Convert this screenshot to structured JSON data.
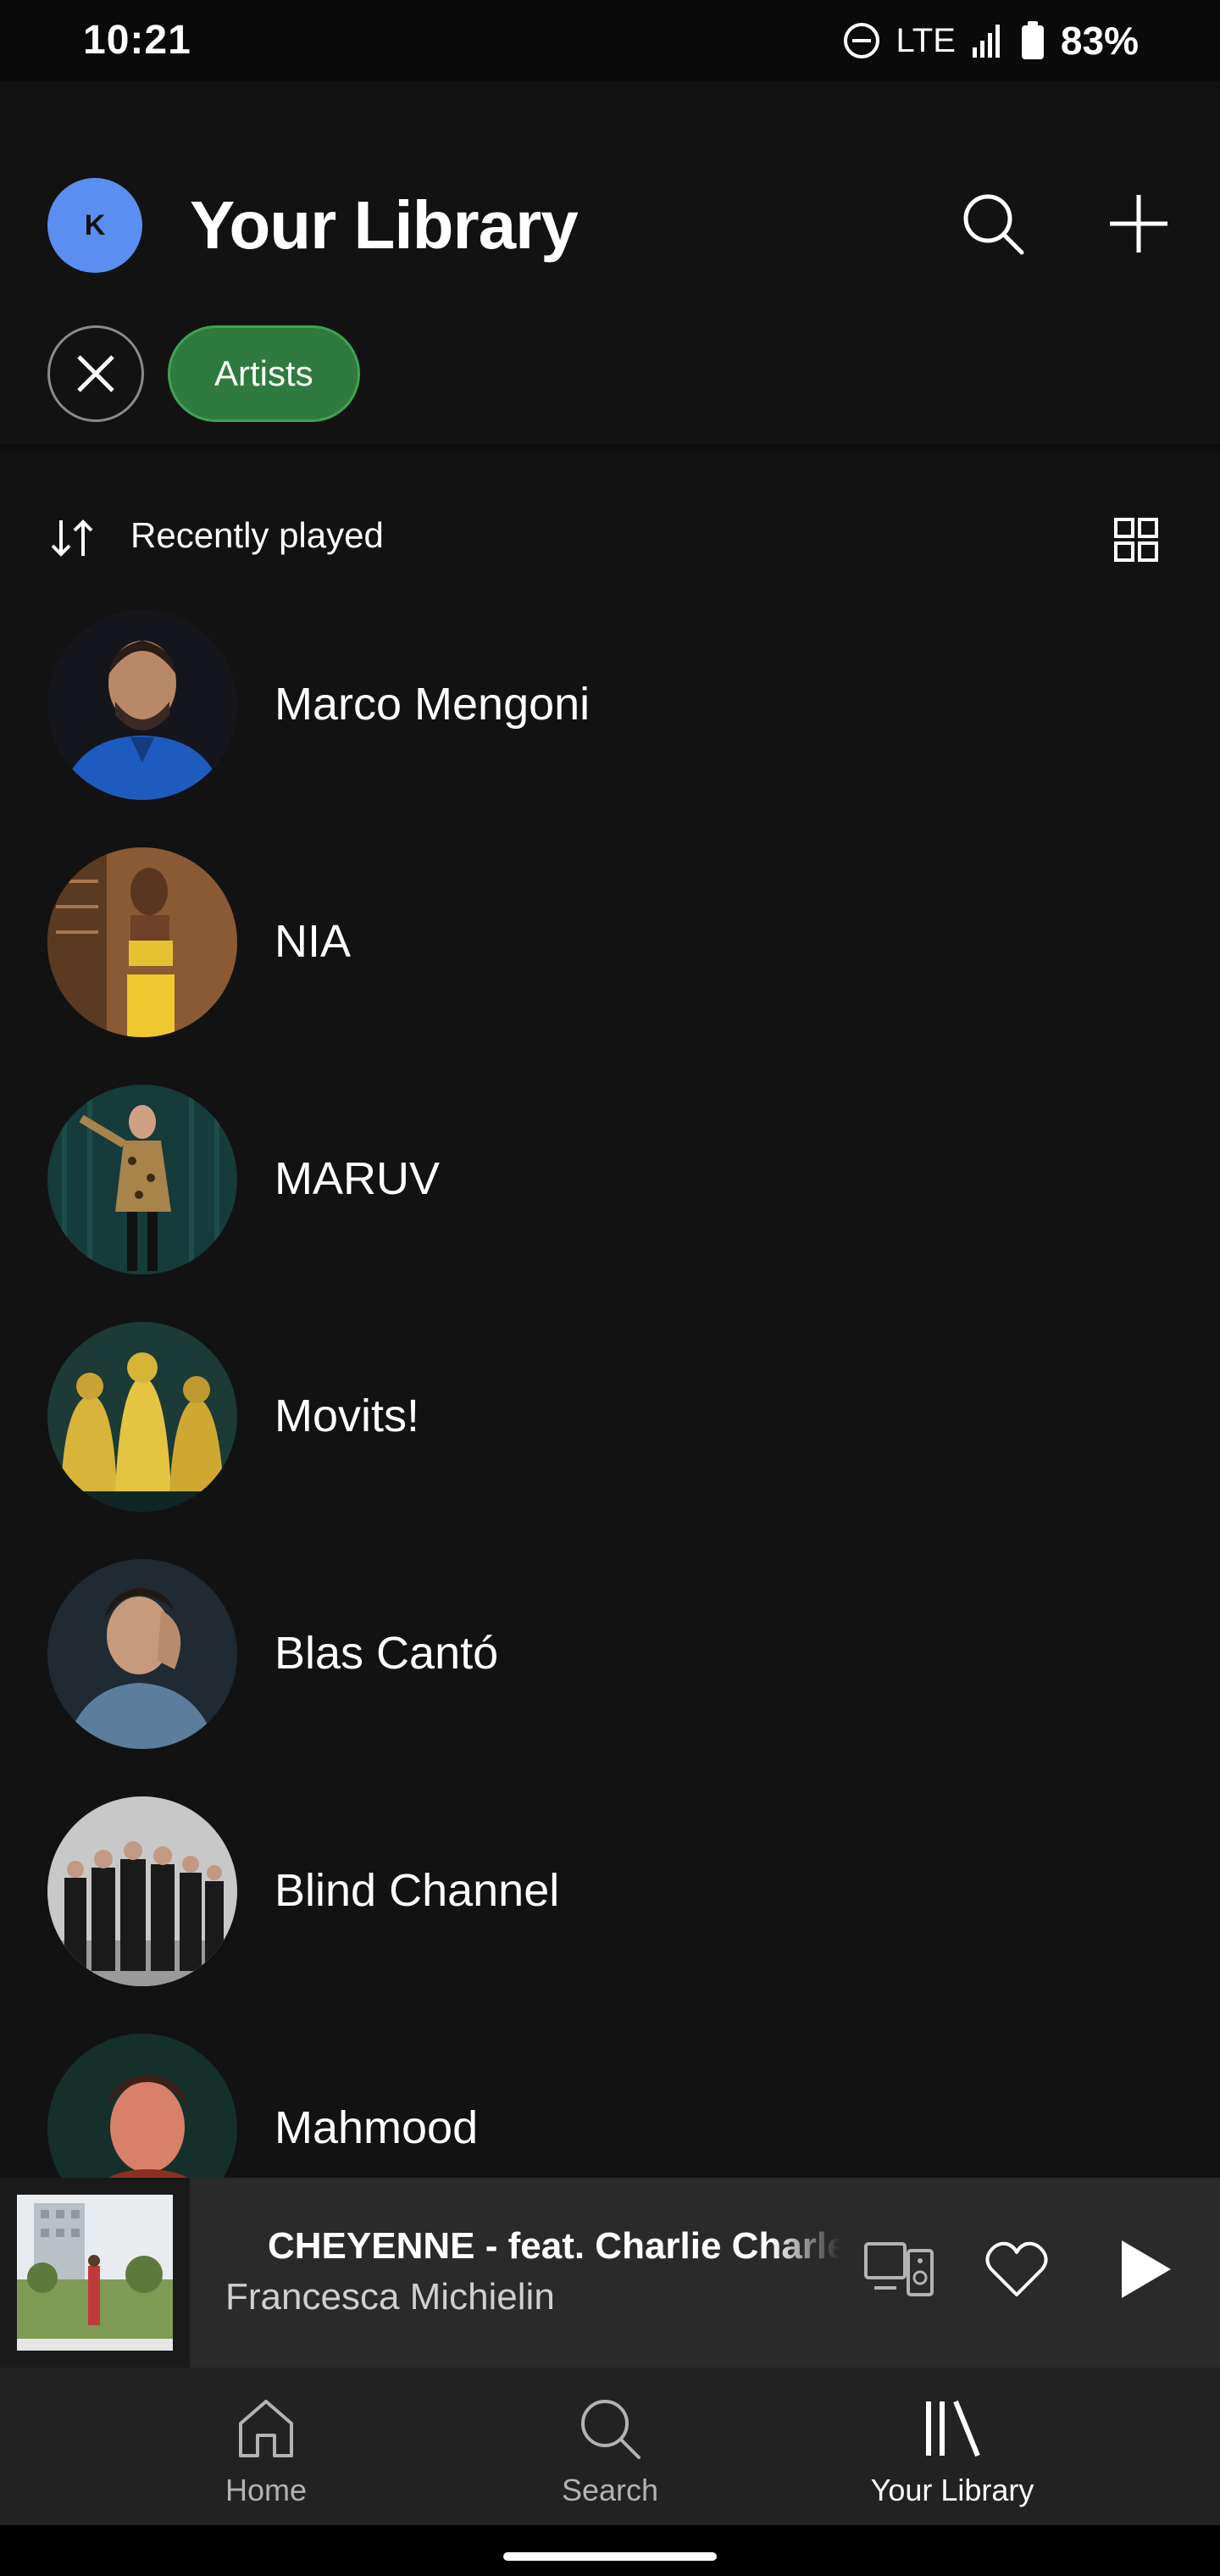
{
  "status_bar": {
    "time": "10:21",
    "network": "LTE",
    "battery": "83%",
    "icons": [
      "dnd-icon",
      "signal-icon",
      "battery-icon"
    ]
  },
  "header": {
    "avatar_initial": "K",
    "title": "Your Library",
    "icons": [
      "search-icon",
      "plus-icon"
    ]
  },
  "filters": {
    "clear_icon": "close-icon",
    "active_chip": "Artists",
    "chip_color": "#2f7a3e"
  },
  "sort": {
    "label": "Recently played",
    "icons": [
      "sort-icon",
      "grid-view-icon"
    ]
  },
  "artists": [
    {
      "name": "Marco Mengoni"
    },
    {
      "name": "NIA"
    },
    {
      "name": "MARUV"
    },
    {
      "name": "Movits!"
    },
    {
      "name": "Blas Cantó"
    },
    {
      "name": "Blind Channel"
    },
    {
      "name": "Mahmood"
    }
  ],
  "player": {
    "title": "CHEYENNE - feat. Charlie Charles",
    "artist": "Francesca Michielin",
    "icons": [
      "devices-icon",
      "heart-icon",
      "play-icon"
    ]
  },
  "bottom_nav": {
    "items": [
      {
        "label": "Home",
        "icon": "home-icon",
        "active": false
      },
      {
        "label": "Search",
        "icon": "search-icon",
        "active": false
      },
      {
        "label": "Your Library",
        "icon": "library-icon",
        "active": true
      }
    ]
  },
  "colors": {
    "background": "#121212",
    "accent_green": "#2f7a3e",
    "avatar_blue": "#5a8ef0"
  }
}
